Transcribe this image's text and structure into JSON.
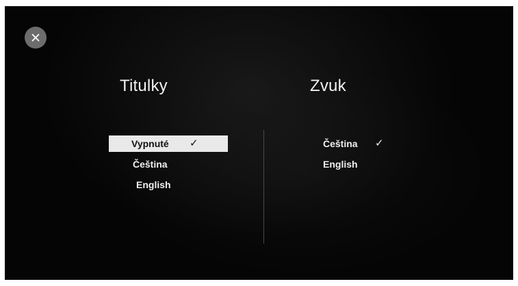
{
  "dialog": {
    "close_label": "✕"
  },
  "subtitles": {
    "title": "Titulky",
    "options": [
      {
        "label": "Vypnuté",
        "selected": true,
        "focused": true
      },
      {
        "label": "Čeština",
        "selected": false,
        "focused": false
      },
      {
        "label": "English",
        "selected": false,
        "focused": false
      }
    ],
    "check_mark": "✓"
  },
  "audio": {
    "title": "Zvuk",
    "options": [
      {
        "label": "Čeština",
        "selected": true,
        "focused": false
      },
      {
        "label": "English",
        "selected": false,
        "focused": false
      }
    ],
    "check_mark": "✓"
  },
  "colors": {
    "background": "#050505",
    "focus_background": "#e9e9e9",
    "close_button": "#6d6d6d",
    "text": "#f0f0f0"
  }
}
